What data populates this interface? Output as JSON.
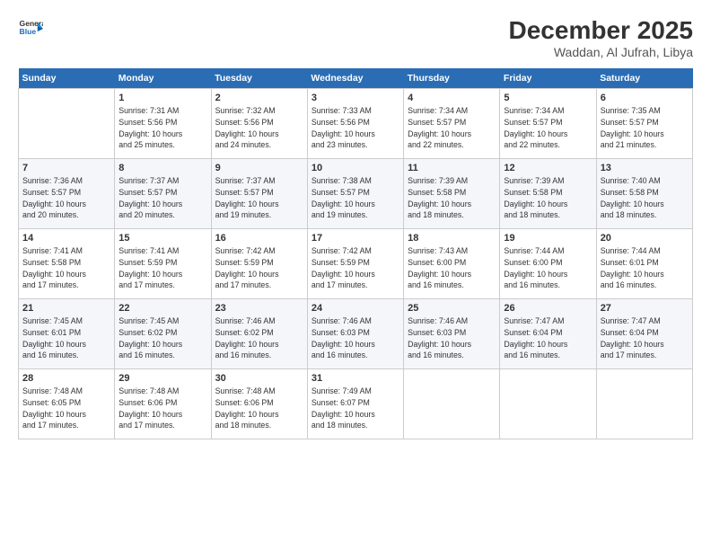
{
  "header": {
    "logo_line1": "General",
    "logo_line2": "Blue",
    "title": "December 2025",
    "subtitle": "Waddan, Al Jufrah, Libya"
  },
  "days_of_week": [
    "Sunday",
    "Monday",
    "Tuesday",
    "Wednesday",
    "Thursday",
    "Friday",
    "Saturday"
  ],
  "weeks": [
    [
      {
        "num": "",
        "info": ""
      },
      {
        "num": "1",
        "info": "Sunrise: 7:31 AM\nSunset: 5:56 PM\nDaylight: 10 hours\nand 25 minutes."
      },
      {
        "num": "2",
        "info": "Sunrise: 7:32 AM\nSunset: 5:56 PM\nDaylight: 10 hours\nand 24 minutes."
      },
      {
        "num": "3",
        "info": "Sunrise: 7:33 AM\nSunset: 5:56 PM\nDaylight: 10 hours\nand 23 minutes."
      },
      {
        "num": "4",
        "info": "Sunrise: 7:34 AM\nSunset: 5:57 PM\nDaylight: 10 hours\nand 22 minutes."
      },
      {
        "num": "5",
        "info": "Sunrise: 7:34 AM\nSunset: 5:57 PM\nDaylight: 10 hours\nand 22 minutes."
      },
      {
        "num": "6",
        "info": "Sunrise: 7:35 AM\nSunset: 5:57 PM\nDaylight: 10 hours\nand 21 minutes."
      }
    ],
    [
      {
        "num": "7",
        "info": "Sunrise: 7:36 AM\nSunset: 5:57 PM\nDaylight: 10 hours\nand 20 minutes."
      },
      {
        "num": "8",
        "info": "Sunrise: 7:37 AM\nSunset: 5:57 PM\nDaylight: 10 hours\nand 20 minutes."
      },
      {
        "num": "9",
        "info": "Sunrise: 7:37 AM\nSunset: 5:57 PM\nDaylight: 10 hours\nand 19 minutes."
      },
      {
        "num": "10",
        "info": "Sunrise: 7:38 AM\nSunset: 5:57 PM\nDaylight: 10 hours\nand 19 minutes."
      },
      {
        "num": "11",
        "info": "Sunrise: 7:39 AM\nSunset: 5:58 PM\nDaylight: 10 hours\nand 18 minutes."
      },
      {
        "num": "12",
        "info": "Sunrise: 7:39 AM\nSunset: 5:58 PM\nDaylight: 10 hours\nand 18 minutes."
      },
      {
        "num": "13",
        "info": "Sunrise: 7:40 AM\nSunset: 5:58 PM\nDaylight: 10 hours\nand 18 minutes."
      }
    ],
    [
      {
        "num": "14",
        "info": "Sunrise: 7:41 AM\nSunset: 5:58 PM\nDaylight: 10 hours\nand 17 minutes."
      },
      {
        "num": "15",
        "info": "Sunrise: 7:41 AM\nSunset: 5:59 PM\nDaylight: 10 hours\nand 17 minutes."
      },
      {
        "num": "16",
        "info": "Sunrise: 7:42 AM\nSunset: 5:59 PM\nDaylight: 10 hours\nand 17 minutes."
      },
      {
        "num": "17",
        "info": "Sunrise: 7:42 AM\nSunset: 5:59 PM\nDaylight: 10 hours\nand 17 minutes."
      },
      {
        "num": "18",
        "info": "Sunrise: 7:43 AM\nSunset: 6:00 PM\nDaylight: 10 hours\nand 16 minutes."
      },
      {
        "num": "19",
        "info": "Sunrise: 7:44 AM\nSunset: 6:00 PM\nDaylight: 10 hours\nand 16 minutes."
      },
      {
        "num": "20",
        "info": "Sunrise: 7:44 AM\nSunset: 6:01 PM\nDaylight: 10 hours\nand 16 minutes."
      }
    ],
    [
      {
        "num": "21",
        "info": "Sunrise: 7:45 AM\nSunset: 6:01 PM\nDaylight: 10 hours\nand 16 minutes."
      },
      {
        "num": "22",
        "info": "Sunrise: 7:45 AM\nSunset: 6:02 PM\nDaylight: 10 hours\nand 16 minutes."
      },
      {
        "num": "23",
        "info": "Sunrise: 7:46 AM\nSunset: 6:02 PM\nDaylight: 10 hours\nand 16 minutes."
      },
      {
        "num": "24",
        "info": "Sunrise: 7:46 AM\nSunset: 6:03 PM\nDaylight: 10 hours\nand 16 minutes."
      },
      {
        "num": "25",
        "info": "Sunrise: 7:46 AM\nSunset: 6:03 PM\nDaylight: 10 hours\nand 16 minutes."
      },
      {
        "num": "26",
        "info": "Sunrise: 7:47 AM\nSunset: 6:04 PM\nDaylight: 10 hours\nand 16 minutes."
      },
      {
        "num": "27",
        "info": "Sunrise: 7:47 AM\nSunset: 6:04 PM\nDaylight: 10 hours\nand 17 minutes."
      }
    ],
    [
      {
        "num": "28",
        "info": "Sunrise: 7:48 AM\nSunset: 6:05 PM\nDaylight: 10 hours\nand 17 minutes."
      },
      {
        "num": "29",
        "info": "Sunrise: 7:48 AM\nSunset: 6:06 PM\nDaylight: 10 hours\nand 17 minutes."
      },
      {
        "num": "30",
        "info": "Sunrise: 7:48 AM\nSunset: 6:06 PM\nDaylight: 10 hours\nand 18 minutes."
      },
      {
        "num": "31",
        "info": "Sunrise: 7:49 AM\nSunset: 6:07 PM\nDaylight: 10 hours\nand 18 minutes."
      },
      {
        "num": "",
        "info": ""
      },
      {
        "num": "",
        "info": ""
      },
      {
        "num": "",
        "info": ""
      }
    ]
  ]
}
